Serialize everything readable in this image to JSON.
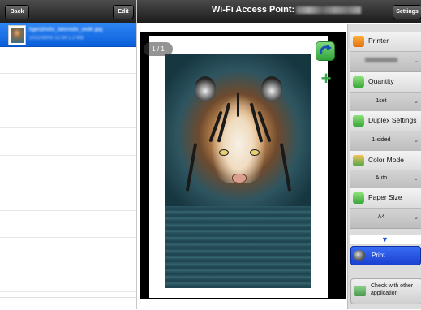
{
  "left_panel": {
    "back_label": "Back",
    "edit_label": "Edit",
    "items": [
      {
        "title": "tigerphoto_lakeside_wide.jpg",
        "subtitle": "2011/08/05 12:34 1.2 MB"
      }
    ]
  },
  "header": {
    "title": "Wi-Fi Access Point:",
    "settings_label": "Settings"
  },
  "preview": {
    "page_indicator": "1 / 1"
  },
  "settings": {
    "printer": {
      "label": "Printer"
    },
    "quantity": {
      "label": "Quantity",
      "value": "1set"
    },
    "duplex": {
      "label": "Duplex Settings",
      "value": "1-sided"
    },
    "color_mode": {
      "label": "Color Mode",
      "value": "Auto"
    },
    "paper_size": {
      "label": "Paper Size",
      "value": "A4"
    }
  },
  "actions": {
    "print_label": "Print",
    "check_label": "Check with other application"
  },
  "colors": {
    "accent": "#1a3fd0",
    "selected_row": "#2f86f4",
    "toolbar": "#2a2a2a"
  }
}
